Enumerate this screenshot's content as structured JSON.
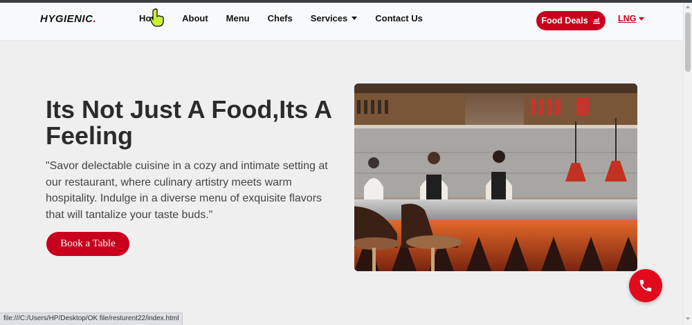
{
  "brand": {
    "name": "HYGIENIC",
    "dot": "."
  },
  "nav": {
    "items": [
      {
        "label": "Home",
        "dropdown": false
      },
      {
        "label": "About",
        "dropdown": false
      },
      {
        "label": "Menu",
        "dropdown": false
      },
      {
        "label": "Chefs",
        "dropdown": false
      },
      {
        "label": "Services",
        "dropdown": true
      },
      {
        "label": "Contact Us",
        "dropdown": false
      }
    ],
    "deals_label": "Food Deals",
    "deals_icon": "food-tray-icon",
    "language_label": "LNG"
  },
  "hero": {
    "title": "Its Not Just A Food,Its A Feeling",
    "description": "\"Savor delectable cuisine in a cozy and intimate setting at our restaurant, where culinary artistry meets warm hospitality. Indulge in a diverse menu of exquisite flavors that will tantalize your taste buds.\"",
    "button_label": "Book a Table",
    "image_icon": "restaurant-kitchen-photo"
  },
  "floating": {
    "icon": "phone-icon"
  },
  "status_bar": {
    "url": "file:///C:/Users/HP/Desktop/OK file/resturent22/index.html"
  },
  "colors": {
    "accent": "#c8001e",
    "background": "#efefef",
    "navbar": "#f8f9fa",
    "phone": "#e00a1c"
  }
}
